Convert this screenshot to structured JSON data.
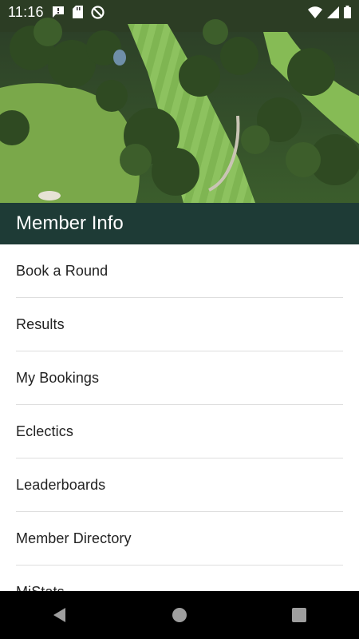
{
  "status_bar": {
    "time": "11:16",
    "icons": [
      "message-notification-icon",
      "sd-card-icon",
      "do-not-disturb-icon",
      "wifi-icon",
      "signal-icon",
      "battery-icon"
    ]
  },
  "header": {
    "title": "Member Info",
    "background_color": "#1e3b36"
  },
  "hero": {
    "image_description_icon": "golf-course-aerial-image"
  },
  "menu": {
    "items": [
      {
        "label": "Book a Round"
      },
      {
        "label": "Results"
      },
      {
        "label": "My Bookings"
      },
      {
        "label": "Eclectics"
      },
      {
        "label": "Leaderboards"
      },
      {
        "label": "Member Directory"
      },
      {
        "label": "MiStats"
      }
    ]
  },
  "navigation_bar": {
    "buttons": [
      "back-icon",
      "home-icon",
      "recents-icon"
    ]
  }
}
